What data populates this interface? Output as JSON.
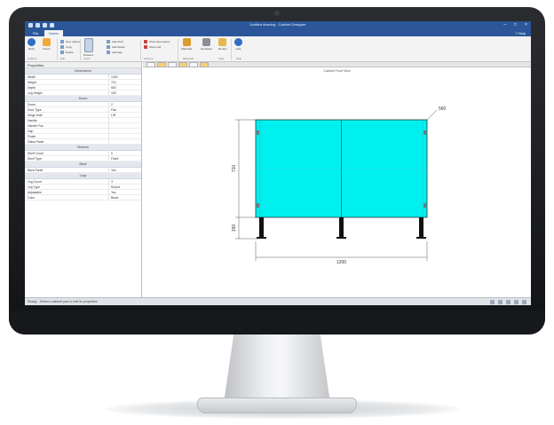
{
  "window": {
    "title": "Untitled drawing - Cabinet Designer"
  },
  "ribbon": {
    "tabs": [
      "File",
      "Home"
    ],
    "active_tab": "Home",
    "help_label": "? Help",
    "buttons": [
      {
        "label": "Back",
        "icon": "back-arrow-icon",
        "color": "#2f6fc4"
      },
      {
        "label": "Doors",
        "icon": "door-icon",
        "color": "#f2a93b"
      },
      {
        "label": "Drawers",
        "icon": "drawer-icon",
        "color": "#c7d4e4"
      },
      {
        "label": "Materials",
        "icon": "materials-icon",
        "color": "#d99a2e"
      },
      {
        "label": "Hardware",
        "icon": "hardware-icon",
        "color": "#8a8f96"
      },
      {
        "label": "Render",
        "icon": "render-icon",
        "color": "#e7b84a"
      },
      {
        "label": "Help",
        "icon": "help-icon",
        "color": "#2f6fc4"
      }
    ],
    "small_items": [
      {
        "label": "New cabinet"
      },
      {
        "label": "Copy"
      },
      {
        "label": "Delete"
      },
      {
        "label": "Add shelf"
      },
      {
        "label": "Add divider"
      },
      {
        "label": "Add legs"
      },
      {
        "label": "Show dimensions"
      },
      {
        "label": "Show grid"
      }
    ],
    "groups": [
      "Cabinet",
      "Edit",
      "Insert",
      "Options",
      "Materials",
      "View",
      "Help"
    ]
  },
  "left_panel": {
    "title": "Properties",
    "sections": [
      {
        "header": "Dimensions",
        "rows": [
          {
            "key": "Width",
            "value": "1200"
          },
          {
            "key": "Height",
            "value": "710"
          },
          {
            "key": "Depth",
            "value": "560"
          },
          {
            "key": "Leg Height",
            "value": "150"
          }
        ]
      },
      {
        "header": "Doors",
        "rows": [
          {
            "key": "Doors",
            "value": "2"
          },
          {
            "key": "Door Type",
            "value": "Flat"
          },
          {
            "key": "Hinge Side",
            "value": "L/R"
          },
          {
            "key": "Handle",
            "value": ""
          },
          {
            "key": "Handle Pos",
            "value": ""
          },
          {
            "key": "Gap",
            "value": ""
          },
          {
            "key": "Finish",
            "value": ""
          },
          {
            "key": "Glass Panel",
            "value": ""
          }
        ]
      },
      {
        "header": "Shelves",
        "rows": [
          {
            "key": "Shelf Count",
            "value": "0"
          },
          {
            "key": "Shelf Type",
            "value": "Fixed"
          }
        ]
      },
      {
        "header": "Back",
        "rows": [
          {
            "key": "Back Panel",
            "value": "Yes"
          }
        ]
      },
      {
        "header": "Legs",
        "rows": [
          {
            "key": "Leg Count",
            "value": "3"
          },
          {
            "key": "Leg Type",
            "value": "Round"
          },
          {
            "key": "Adjustable",
            "value": "Yes"
          },
          {
            "key": "Color",
            "value": "Black"
          }
        ]
      }
    ]
  },
  "drawing": {
    "view_title": "Cabinet Front View",
    "width_label": "1200",
    "height_label": "710",
    "leg_label": "150",
    "depth_label": "560",
    "cabinet_color": "#00f0f0",
    "leg_color": "#111111"
  },
  "status": {
    "text": "Ready - Select a cabinet part to edit its properties"
  },
  "colors": {
    "ribbon_blue": "#2b579a",
    "bezel": "#1b1c1f"
  }
}
